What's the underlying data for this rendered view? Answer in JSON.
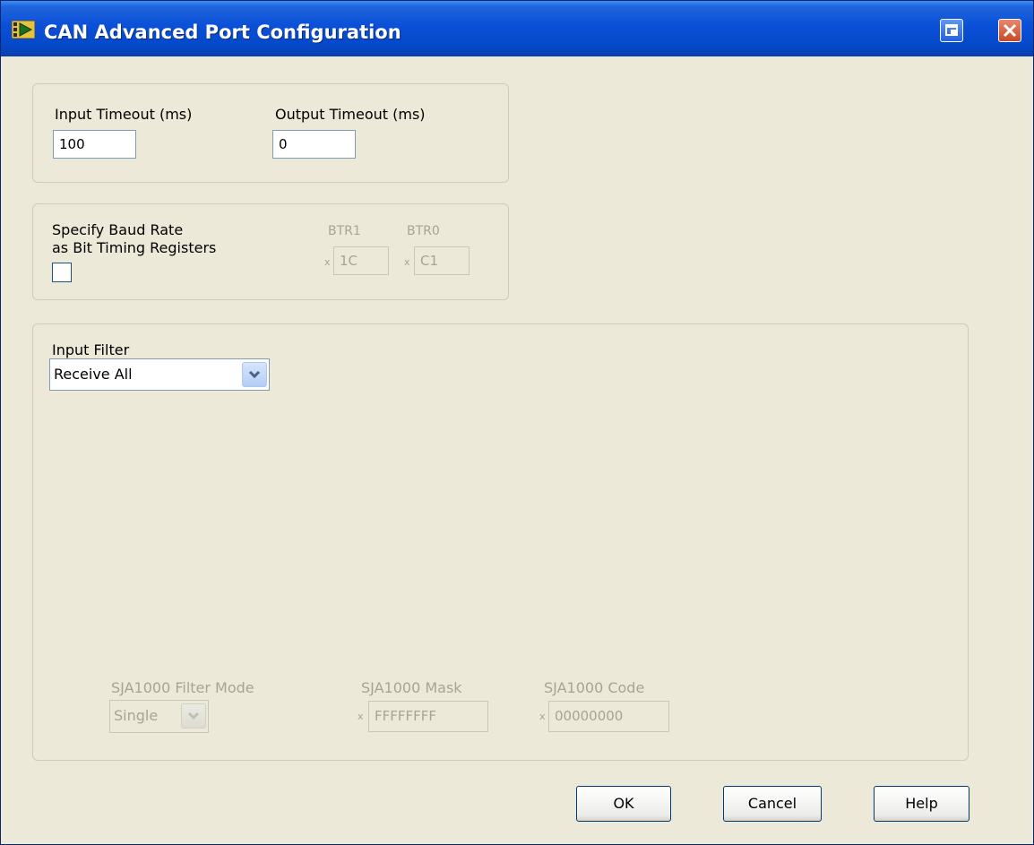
{
  "window": {
    "title": "CAN Advanced Port Configuration",
    "icons": {
      "app": "labview-vi-icon",
      "restore": "restore-window-icon",
      "close": "close-icon"
    }
  },
  "timeouts": {
    "input_label": "Input Timeout (ms)",
    "input_value": "100",
    "output_label": "Output Timeout (ms)",
    "output_value": "0"
  },
  "baud": {
    "checkbox_label_line1": "Specify Baud Rate",
    "checkbox_label_line2": "as Bit Timing Registers",
    "checked": false,
    "btr1_label": "BTR1",
    "btr1_prefix": "x",
    "btr1_value": "1C",
    "btr0_label": "BTR0",
    "btr0_prefix": "x",
    "btr0_value": "C1"
  },
  "filter": {
    "label": "Input Filter",
    "selected": "Receive All",
    "mode_label": "SJA1000 Filter Mode",
    "mode_value": "Single",
    "mask_label": "SJA1000 Mask",
    "mask_prefix": "x",
    "mask_value": "FFFFFFFF",
    "code_label": "SJA1000 Code",
    "code_prefix": "x",
    "code_value": "00000000"
  },
  "buttons": {
    "ok": "OK",
    "cancel": "Cancel",
    "help": "Help"
  },
  "colors": {
    "titlebar": "#0a50d8",
    "window_bg": "#ece9d8",
    "disabled_text": "#a7a495",
    "button_border": "#003c74"
  }
}
